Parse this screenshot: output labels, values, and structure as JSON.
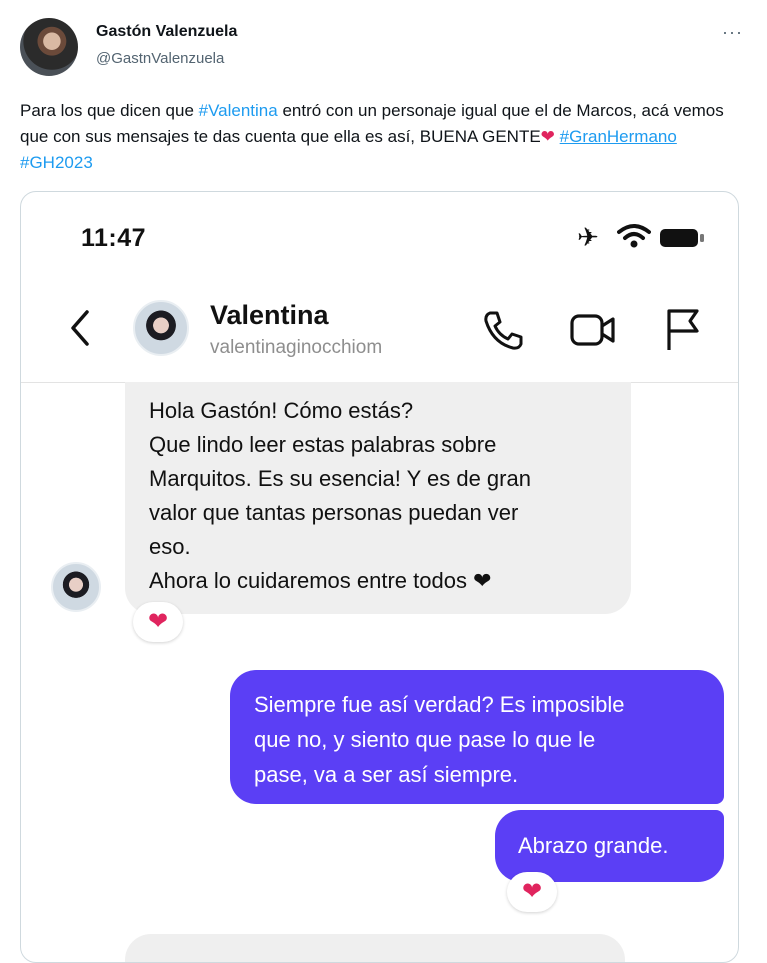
{
  "tweet": {
    "author_name": "Gastón Valenzuela",
    "author_handle": "@GastnValenzuela",
    "more_label": "···",
    "text_parts": {
      "p1": "Para los que dicen que ",
      "hashtag_valentina": "#Valentina",
      "p2": " entró con un personaje igual que el de Marcos, acá vemos que con sus mensajes te das cuenta que ella es así, BUENA GENTE",
      "heart": "❤",
      "hashtag_granhermano": "#GranHermano",
      "hashtag_gh2023": "#GH2023"
    }
  },
  "phone": {
    "status_time": "11:47",
    "contact": {
      "name": "Valentina",
      "handle": "valentinaginocchiom"
    },
    "messages": [
      {
        "direction": "in",
        "lines": [
          "Hola Gastón!  Cómo estás?",
          "Que lindo leer estas palabras sobre",
          "Marquitos. Es su esencia! Y es de gran",
          "valor que tantas personas puedan ver",
          "eso.",
          "Ahora lo cuidaremos entre todos ❤"
        ],
        "reaction": "❤"
      },
      {
        "direction": "out",
        "lines": [
          "Siempre fue así verdad? Es imposible",
          "que no, y siento que pase lo que le",
          "pase, va a ser así siempre."
        ]
      },
      {
        "direction": "out",
        "text": "Abrazo grande.",
        "reaction": "❤"
      }
    ]
  },
  "icons": [
    "avatar",
    "more-icon",
    "airplane-icon",
    "wifi-icon",
    "battery-icon",
    "back-icon",
    "call-icon",
    "video-icon",
    "flag-icon",
    "heart-icon"
  ],
  "colors": {
    "link": "#1d9bf0",
    "outgoing_bubble": "#5b3ff5",
    "incoming_bubble": "#efefef",
    "heart": "#e0245e"
  }
}
